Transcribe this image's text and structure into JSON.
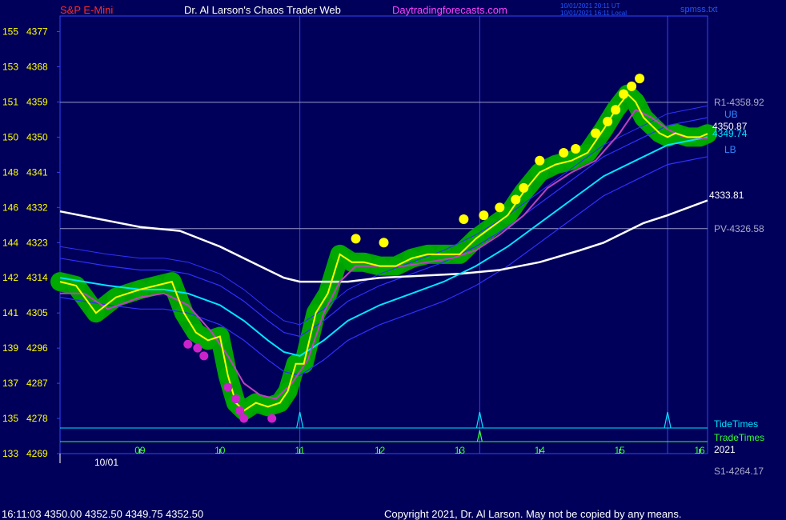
{
  "header": {
    "symbol": "S&P E-Mini",
    "site_title": "Dr. Al Larson's Chaos Trader Web",
    "site_link": "Daytradingforecasts.com",
    "timestamp_ut": "10/01/2021 20:11 UT",
    "timestamp_local": "10/01/2021 16:11 Local",
    "filename": "spmss.txt"
  },
  "footer": {
    "quote": "16:11:03  4350.00 4352.50 4349.75 4352.50",
    "copyright": "Copyright 2021, Dr. Al Larson. May not be copied by any means."
  },
  "colors": {
    "background": "#00005a",
    "plot_border": "#3344ff",
    "axis_text": "#ffff00",
    "hour_text": "#33ff33",
    "price": "#ffff00",
    "halo": "#00aa00",
    "ema_fast": "#bb44bb",
    "ema_mid": "#00e5ff",
    "ema_slow": "#ffffff",
    "bands": "#3030ff",
    "pivot_lines": "#9999cc"
  },
  "chart_data": {
    "type": "line",
    "title": "S&P E-Mini",
    "date_label": "10/01",
    "year_label": "2021",
    "y_axis": {
      "ylim": [
        4269,
        4381
      ],
      "ticks": [
        {
          "left": "155",
          "value": 4377
        },
        {
          "left": "153",
          "value": 4368
        },
        {
          "left": "151",
          "value": 4359
        },
        {
          "left": "150",
          "value": 4350
        },
        {
          "left": "148",
          "value": 4341
        },
        {
          "left": "146",
          "value": 4332
        },
        {
          "left": "144",
          "value": 4323
        },
        {
          "left": "142",
          "value": 4314
        },
        {
          "left": "141",
          "value": 4305
        },
        {
          "left": "139",
          "value": 4296
        },
        {
          "left": "137",
          "value": 4287
        },
        {
          "left": "135",
          "value": 4278
        },
        {
          "left": "133",
          "value": 4269
        }
      ]
    },
    "x_axis": {
      "xlim": [
        8.0,
        16.1
      ],
      "hours": [
        9,
        10,
        11,
        12,
        13,
        14,
        15,
        16
      ],
      "hour_labels": [
        "09",
        "10",
        "11",
        "12",
        "13",
        "14",
        "15",
        "16"
      ]
    },
    "levels": [
      {
        "name": "R1",
        "label": "R1-4358.92",
        "value": 4358.92
      },
      {
        "name": "PV",
        "label": "PV-4326.58",
        "value": 4326.58
      },
      {
        "name": "S1",
        "label": "S1-4264.17",
        "value": 4264.17
      }
    ],
    "band_labels": {
      "upper": "UB",
      "lower": "LB"
    },
    "last_values": {
      "price": "4350.87",
      "fast": "4349.74",
      "slow": "4333.81"
    },
    "vertical_markers": [
      11.0,
      13.25,
      15.6
    ],
    "tide_times": {
      "label": "TideTimes",
      "spikes": [
        11.0,
        13.25,
        15.6
      ]
    },
    "trade_times": {
      "label": "TradeTimes",
      "spikes": [
        13.25
      ]
    },
    "price_series": {
      "name": "price",
      "x": [
        8.0,
        8.2,
        8.45,
        8.7,
        9.0,
        9.2,
        9.4,
        9.55,
        9.7,
        9.85,
        10.0,
        10.1,
        10.2,
        10.3,
        10.45,
        10.6,
        10.75,
        10.85,
        10.95,
        11.05,
        11.2,
        11.35,
        11.5,
        11.65,
        11.8,
        12.0,
        12.2,
        12.4,
        12.6,
        12.8,
        13.0,
        13.2,
        13.4,
        13.6,
        13.8,
        14.0,
        14.2,
        14.4,
        14.6,
        14.8,
        14.95,
        15.1,
        15.2,
        15.3,
        15.4,
        15.5,
        15.6,
        15.7,
        15.85,
        16.0,
        16.1
      ],
      "values": [
        4313,
        4312,
        4305,
        4309,
        4311,
        4312,
        4313,
        4305,
        4300,
        4298,
        4299,
        4289,
        4282,
        4280,
        4282,
        4281,
        4282,
        4285,
        4292,
        4292,
        4305,
        4310,
        4320,
        4318,
        4318,
        4317,
        4317,
        4319,
        4320,
        4320,
        4320,
        4324,
        4327,
        4330,
        4336,
        4341,
        4343,
        4344,
        4346,
        4352,
        4357,
        4361,
        4359,
        4355,
        4353,
        4351,
        4350,
        4351,
        4350,
        4350,
        4350.87
      ]
    },
    "ema_fast": {
      "name": "fast",
      "x": [
        8.0,
        8.3,
        8.6,
        9.0,
        9.3,
        9.6,
        9.9,
        10.1,
        10.3,
        10.5,
        10.7,
        10.9,
        11.1,
        11.3,
        11.5,
        11.7,
        12.0,
        12.3,
        12.6,
        12.9,
        13.2,
        13.5,
        13.8,
        14.1,
        14.4,
        14.7,
        15.0,
        15.2,
        15.4,
        15.6,
        15.8,
        16.1
      ],
      "values": [
        4310,
        4310,
        4306,
        4309,
        4310,
        4307,
        4300,
        4294,
        4287,
        4284,
        4283,
        4287,
        4293,
        4305,
        4313,
        4317,
        4317,
        4317,
        4318,
        4319,
        4321,
        4325,
        4330,
        4337,
        4341,
        4344,
        4351,
        4357,
        4355,
        4352,
        4350,
        4349.74
      ]
    },
    "ema_mid": {
      "name": "mid",
      "x": [
        8.0,
        8.3,
        8.6,
        9.0,
        9.3,
        9.6,
        10.0,
        10.3,
        10.6,
        10.8,
        11.0,
        11.3,
        11.6,
        12.0,
        12.4,
        12.8,
        13.2,
        13.6,
        14.0,
        14.4,
        14.8,
        15.2,
        15.6,
        16.1
      ],
      "values": [
        4314,
        4313,
        4312,
        4311,
        4311,
        4310,
        4307,
        4303,
        4298,
        4295,
        4294,
        4298,
        4303,
        4307,
        4310,
        4313,
        4317,
        4322,
        4328,
        4334,
        4340,
        4344,
        4348,
        4350
      ]
    },
    "ema_slow": {
      "name": "slow",
      "x": [
        8.0,
        8.5,
        9.0,
        9.5,
        10.0,
        10.5,
        10.8,
        11.0,
        11.3,
        11.6,
        12.0,
        12.5,
        13.0,
        13.5,
        14.0,
        14.5,
        14.8,
        15.0,
        15.3,
        15.6,
        16.1
      ],
      "values": [
        4331,
        4329,
        4327,
        4326,
        4322,
        4317,
        4314,
        4313,
        4313,
        4313,
        4314,
        4314.5,
        4315,
        4316,
        4318,
        4321,
        4323,
        4325,
        4328,
        4330,
        4333.81
      ]
    },
    "magenta_dots": [
      [
        9.6,
        4297
      ],
      [
        9.72,
        4296
      ],
      [
        9.8,
        4294
      ],
      [
        10.1,
        4286
      ],
      [
        10.2,
        4283
      ],
      [
        10.25,
        4280
      ],
      [
        10.3,
        4278
      ],
      [
        10.65,
        4278
      ]
    ],
    "yellow_dots": [
      [
        11.7,
        4324
      ],
      [
        12.05,
        4323
      ],
      [
        13.05,
        4329
      ],
      [
        13.3,
        4330
      ],
      [
        13.5,
        4332
      ],
      [
        13.7,
        4334
      ],
      [
        13.8,
        4337
      ],
      [
        14.0,
        4344
      ],
      [
        14.3,
        4346
      ],
      [
        14.45,
        4347
      ],
      [
        14.7,
        4351
      ],
      [
        14.85,
        4354
      ],
      [
        14.95,
        4357
      ],
      [
        15.05,
        4361
      ],
      [
        15.15,
        4363
      ],
      [
        15.25,
        4365
      ]
    ]
  }
}
